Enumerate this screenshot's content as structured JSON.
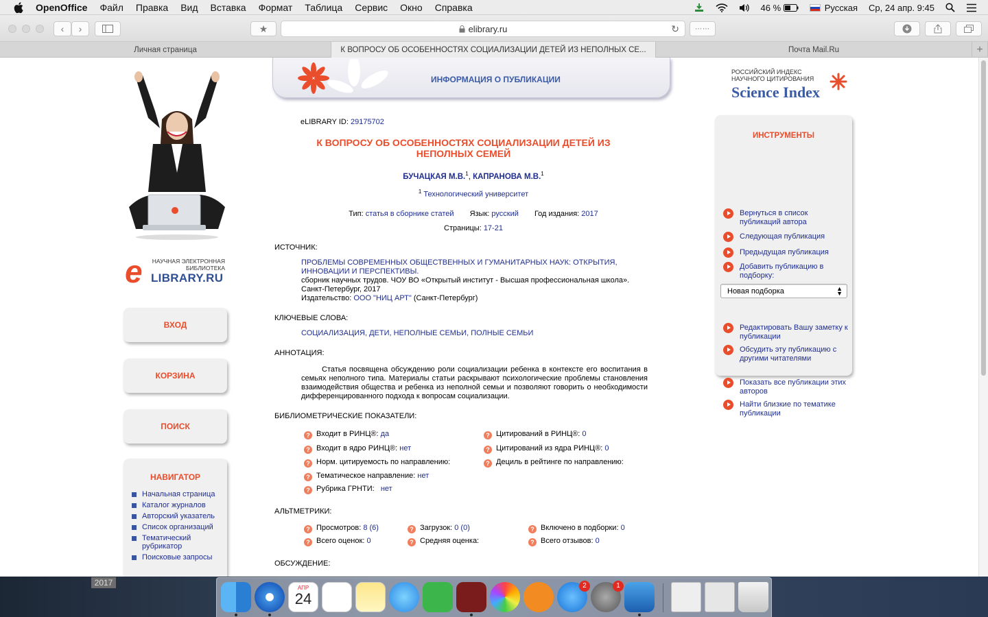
{
  "menubar": {
    "app": "OpenOffice",
    "items": [
      "Файл",
      "Правка",
      "Вид",
      "Вставка",
      "Формат",
      "Таблица",
      "Сервис",
      "Окно",
      "Справка"
    ],
    "battery": "46 %",
    "input_lang": "Русская",
    "datetime": "Ср, 24 апр.  9:45"
  },
  "browser": {
    "url": "elibrary.ru",
    "tabs": [
      "Личная страница",
      "К ВОПРОСУ ОБ ОСОБЕННОСТЯХ СОЦИАЛИЗАЦИИ ДЕТЕЙ ИЗ НЕПОЛНЫХ СЕ...",
      "Почта Mail.Ru"
    ]
  },
  "left": {
    "logo_small": "НАУЧНАЯ ЭЛЕКТРОННАЯ БИБЛИОТЕКА",
    "logo_letter": "e",
    "logo_big": "LIBRARY.RU",
    "buttons": [
      "ВХОД",
      "КОРЗИНА",
      "ПОИСК"
    ],
    "navigator": {
      "title": "НАВИГАТОР",
      "items": [
        "Начальная страница",
        "Каталог журналов",
        "Авторский указатель",
        "Список организаций",
        "Тематический рубрикатор",
        "Поисковые запросы"
      ]
    }
  },
  "banner": {
    "title": "ИНФОРМАЦИЯ О ПУБЛИКАЦИИ"
  },
  "pub": {
    "id_label": "eLIBRARY ID:",
    "id": "29175702",
    "title": "К ВОПРОСУ ОБ ОСОБЕННОСТЯХ СОЦИАЛИЗАЦИИ ДЕТЕЙ ИЗ НЕПОЛНЫХ СЕМЕЙ",
    "author1": "БУЧАЦКАЯ М.В.",
    "author2": "КАПРАНОВА М.В.",
    "sup": "1",
    "sep": ",",
    "affiliation": "Технологический университет",
    "type_label": "Тип:",
    "type": "статья в сборнике статей",
    "lang_label": "Язык:",
    "lang": "русский",
    "year_label": "Год издания:",
    "year": "2017",
    "pages_label": "Страницы:",
    "pages": "17-21",
    "source_label": "ИСТОЧНИК:",
    "source_title": "ПРОБЛЕМЫ СОВРЕМЕННЫХ ОБЩЕСТВЕННЫХ И ГУМАНИТАРНЫХ НАУК: ОТКРЫТИЯ, ИННОВАЦИИ И ПЕРСПЕКТИВЫ.",
    "source_desc": "сборник научных трудов. ЧОУ ВО «Открытый институт - Высшая профессиональная школа».",
    "source_city": "Санкт-Петербург, 2017",
    "publisher_label": "Издательство:",
    "publisher": "ООО \"НИЦ АРТ\"",
    "publisher_city": "(Санкт-Петербург)",
    "keywords_label": "КЛЮЧЕВЫЕ СЛОВА:",
    "keywords": "СОЦИАЛИЗАЦИЯ, ДЕТИ, НЕПОЛНЫЕ СЕМЬИ, ПОЛНЫЕ СЕМЬИ",
    "abstract_label": "АННОТАЦИЯ:",
    "abstract": "Статья посвящена обсуждению роли социализации ребенка в контексте его воспитания в семьях неполного типа. Материалы статьи раскрывают психологические проблемы становления взаимодействия общества и ребенка из неполной семьи и позволяют говорить о необходимости дифференцированного подхода к вопросам социализации.",
    "biblio_label": "БИБЛИОМЕТРИЧЕСКИЕ ПОКАЗАТЕЛИ:",
    "biblio_left": [
      {
        "label": "Входит в РИНЦ®:",
        "value": "да"
      },
      {
        "label": "Входит в ядро РИНЦ®:",
        "value": "нет"
      },
      {
        "label": "Норм. цитируемость по направлению:",
        "value": ""
      },
      {
        "label": "Тематическое направление:",
        "value": "нет"
      },
      {
        "label": "Рубрика ГРНТИ:",
        "value": "нет"
      }
    ],
    "biblio_right": [
      {
        "label": "Цитирований в РИНЦ®:",
        "value": "0"
      },
      {
        "label": "Цитирований из ядра РИНЦ®:",
        "value": "0"
      },
      {
        "label": "Дециль в рейтинге по направлению:",
        "value": ""
      }
    ],
    "alt_label": "АЛЬТМЕТРИКИ:",
    "alt": [
      {
        "label": "Просмотров:",
        "value": "8 (6)"
      },
      {
        "label": "Загрузок:",
        "value": "0 (0)"
      },
      {
        "label": "Включено в подборки:",
        "value": "0"
      },
      {
        "label": "Всего оценок:",
        "value": "0"
      },
      {
        "label": "Средняя оценка:",
        "value": ""
      },
      {
        "label": "Всего отзывов:",
        "value": "0"
      }
    ],
    "discussion_label": "ОБСУЖДЕНИЕ:"
  },
  "right": {
    "sci_small": "РОССИЙСКИЙ ИНДЕКС НАУЧНОГО ЦИТИРОВАНИЯ",
    "sci_big": "Science Index",
    "tools_title": "ИНСТРУМЕНТЫ",
    "tools": [
      "Вернуться в список публикаций автора",
      "Следующая публикация",
      "Предыдущая публикация",
      "Добавить публикацию в подборку:",
      "Редактировать Вашу заметку к публикации",
      "Обсудить эту публикацию с другими читателями",
      "Показать все публикации этих авторов",
      "Найти близкие по тематике публикации"
    ],
    "select_value": "Новая подборка"
  },
  "desktop": {
    "year_badge": "2017",
    "calendar_month": "АПР",
    "calendar_day": "24",
    "badges": [
      "2",
      "1"
    ]
  }
}
